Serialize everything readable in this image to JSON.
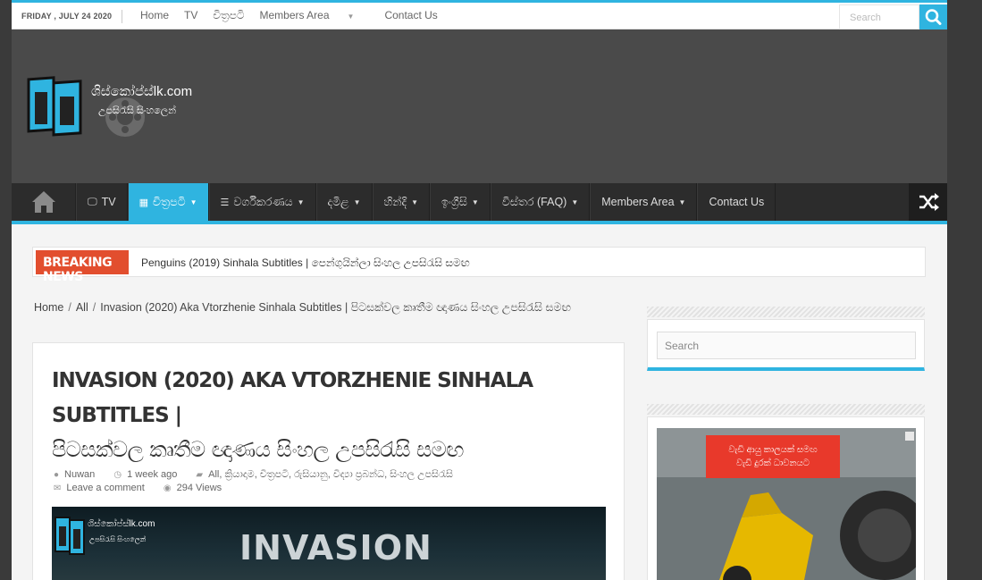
{
  "topbar": {
    "date": "FRIDAY , JULY 24 2020",
    "nav": [
      {
        "label": "Home"
      },
      {
        "label": "TV"
      },
      {
        "label": "චිත්‍රපටි"
      },
      {
        "label": "Members Area",
        "caret": true
      },
      {
        "label": "Contact Us"
      }
    ],
    "search_placeholder": "Search"
  },
  "logo": {
    "title": "ශිස්කෝප්ස්lk.com",
    "tagline": "උපසිරැසි සිංහලෙන්"
  },
  "mainnav": {
    "items": [
      {
        "label": "TV",
        "icon": "tv-icon"
      },
      {
        "label": "චිත්‍රපටි",
        "icon": "film-icon",
        "caret": true,
        "active": true
      },
      {
        "label": "වර්ගීකරණය",
        "icon": "list-icon",
        "caret": true
      },
      {
        "label": "දමිළ",
        "caret": true
      },
      {
        "label": "හින්දි",
        "caret": true
      },
      {
        "label": "ඉංග්‍රීසි",
        "caret": true
      },
      {
        "label": "විස්තර (FAQ)",
        "caret": true
      },
      {
        "label": "Members Area",
        "caret": true
      },
      {
        "label": "Contact Us"
      }
    ]
  },
  "breaking": {
    "label": "BREAKING NEWS",
    "text": "Penguins (2019) Sinhala Subtitles | පෙන්ගුයින්ලා සිංහල උපසිරැසි සමඟ"
  },
  "breadcrumb": {
    "home": "Home",
    "cat": "All",
    "current": "Invasion (2020) Aka Vtorzhenie Sinhala Subtitles | පිටසක්වල කෘතීම ඥාණය සිංහල උපසිරැසි සමඟ"
  },
  "post": {
    "title_en": "Invasion (2020) Aka Vtorzhenie Sinhala Subtitles |",
    "title_si": "පිටසක්වල කෘතීම ඥාණය සිංහල උපසිරැසි සමඟ",
    "author": "Nuwan",
    "time": "1 week ago",
    "categories": "All, ක්‍රියාදාම, චිත්‍රපටි, රුසියානු, විද්‍යා ප්‍රබන්ධ, සිංහල උපසිරැසි",
    "comment": "Leave a comment",
    "views": "294 Views",
    "feature_title": "INVASION",
    "feature_logo": "ශිස්කෝප්ස්lk.com",
    "feature_tagline": "උපසිරැසි සිංහලෙන්"
  },
  "sidebar": {
    "search_placeholder": "Search",
    "ad_line1": "වැඩි ආයු කාලයක් සමඟ",
    "ad_line2": "වැඩි දුරක් ධාවනයට"
  },
  "colors": {
    "accent": "#2fb4e0",
    "breaking": "#e24e2e",
    "nav_bg": "#2c2c2c",
    "header_bg": "#4a4a4a"
  }
}
